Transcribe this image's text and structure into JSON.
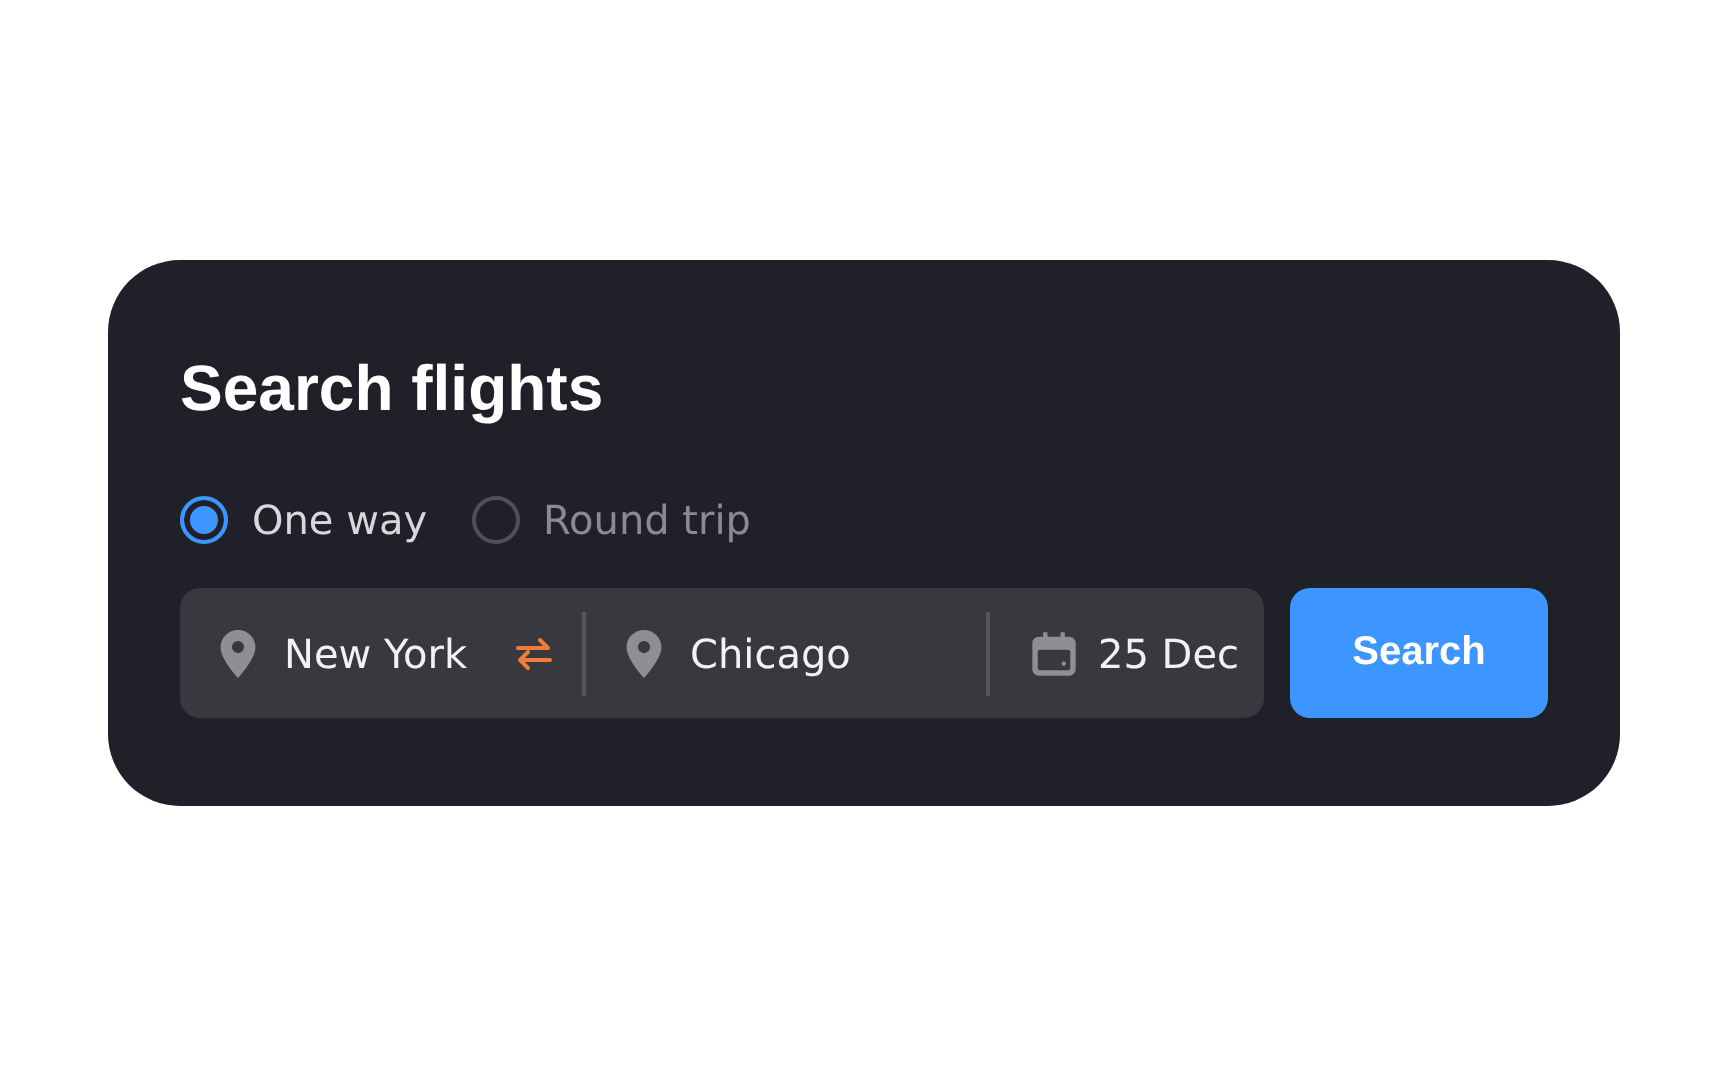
{
  "title": "Search flights",
  "trip_types": [
    {
      "label": "One way",
      "selected": true
    },
    {
      "label": "Round trip",
      "selected": false
    }
  ],
  "from": {
    "value": "New York"
  },
  "to": {
    "value": "Chicago"
  },
  "date": {
    "value": "25 Dec"
  },
  "search_button": {
    "label": "Search"
  }
}
